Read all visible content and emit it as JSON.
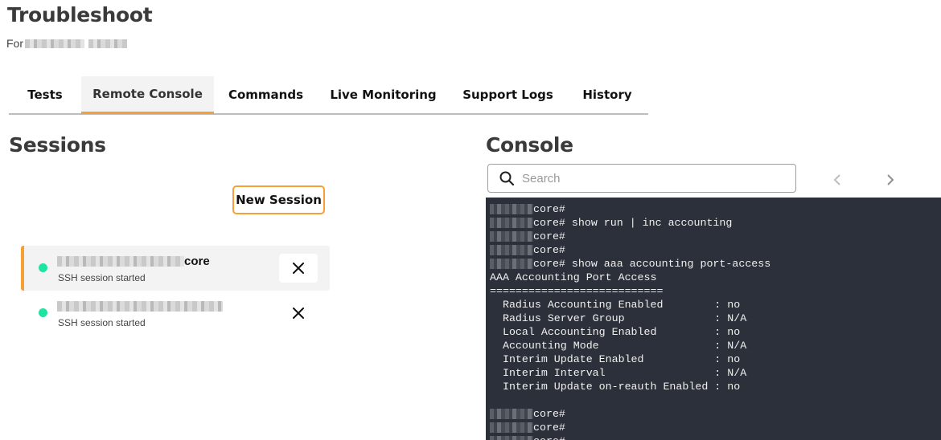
{
  "page": {
    "title": "Troubleshoot",
    "for_label": "For"
  },
  "tabs": [
    {
      "label": "Tests",
      "active": false
    },
    {
      "label": "Remote Console",
      "active": true
    },
    {
      "label": "Commands",
      "active": false
    },
    {
      "label": "Live Monitoring",
      "active": false
    },
    {
      "label": "Support Logs",
      "active": false
    },
    {
      "label": "History",
      "active": false
    }
  ],
  "sessions": {
    "title": "Sessions",
    "new_session_label": "New Session",
    "items": [
      {
        "name_suffix": "core",
        "status": "SSH session started",
        "active": true,
        "status_color": "#1de5a0"
      },
      {
        "name_suffix": "",
        "status": "SSH session started",
        "active": false,
        "status_color": "#1de5a0"
      }
    ]
  },
  "console": {
    "title": "Console",
    "search_placeholder": "Search",
    "prompt": "core#",
    "lines": [
      {
        "host": true,
        "text": "core#"
      },
      {
        "host": true,
        "text": "core# show run | inc accounting"
      },
      {
        "host": true,
        "text": "core#"
      },
      {
        "host": true,
        "text": "core#"
      },
      {
        "host": true,
        "text": "core# show aaa accounting port-access"
      },
      {
        "host": false,
        "text": "AAA Accounting Port Access"
      },
      {
        "host": false,
        "text": "==========================="
      },
      {
        "host": false,
        "text": "  Radius Accounting Enabled        : no"
      },
      {
        "host": false,
        "text": "  Radius Server Group              : N/A"
      },
      {
        "host": false,
        "text": "  Local Accounting Enabled         : no"
      },
      {
        "host": false,
        "text": "  Accounting Mode                  : N/A"
      },
      {
        "host": false,
        "text": "  Interim Update Enabled           : no"
      },
      {
        "host": false,
        "text": "  Interim Interval                 : N/A"
      },
      {
        "host": false,
        "text": "  Interim Update on-reauth Enabled : no"
      },
      {
        "host": false,
        "text": ""
      },
      {
        "host": true,
        "text": "core#"
      },
      {
        "host": true,
        "text": "core#"
      },
      {
        "host": true,
        "text": "core#"
      }
    ]
  },
  "colors": {
    "accent": "#f5a034",
    "console_bg": "#2b303b",
    "status_ok": "#1de5a0"
  },
  "icons": {
    "search": "search-icon",
    "close": "close-icon",
    "prev": "chevron-left-icon",
    "next": "chevron-right-icon"
  }
}
